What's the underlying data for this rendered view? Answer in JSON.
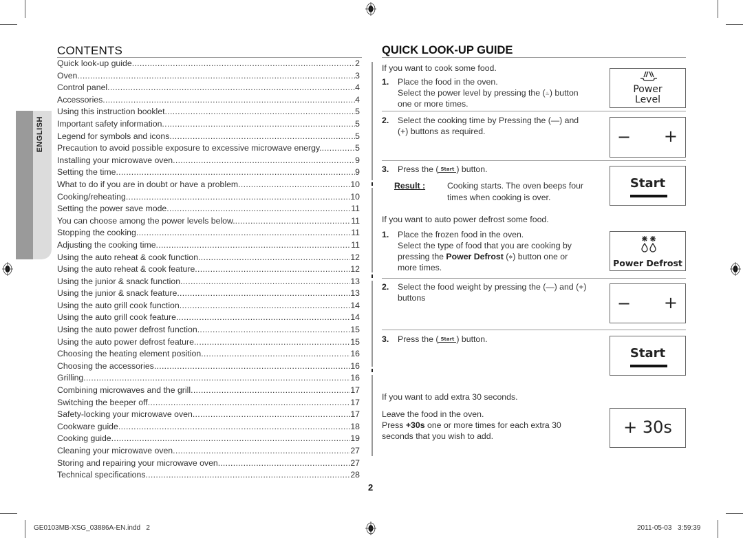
{
  "contents": {
    "title": "CONTENTS",
    "language_tab": "ENGLISH",
    "items": [
      {
        "title": "Quick look-up guide",
        "page": "2"
      },
      {
        "title": "Oven",
        "page": "3"
      },
      {
        "title": "Control panel",
        "page": "4"
      },
      {
        "title": "Accessories",
        "page": "4"
      },
      {
        "title": "Using this instruction booklet",
        "page": "5"
      },
      {
        "title": "Important safety information",
        "page": "5"
      },
      {
        "title": "Legend for symbols and icons",
        "page": "5"
      },
      {
        "title": "Precaution to avoid possible exposure to excessive microwave energy.",
        "page": "5"
      },
      {
        "title": "Installing your microwave oven",
        "page": "9"
      },
      {
        "title": "Setting the time",
        "page": "9"
      },
      {
        "title": "What to do if you are in doubt or have a problem",
        "page": "10"
      },
      {
        "title": "Cooking/reheating",
        "page": "10"
      },
      {
        "title": "Setting the power save mode",
        "page": "11"
      },
      {
        "title": "You can choose among the power levels below.",
        "page": "11"
      },
      {
        "title": "Stopping the cooking",
        "page": "11"
      },
      {
        "title": "Adjusting the cooking time",
        "page": "11"
      },
      {
        "title": "Using the auto reheat & cook function",
        "page": "12"
      },
      {
        "title": "Using the auto reheat & cook feature",
        "page": "12"
      },
      {
        "title": "Using the junior & snack function",
        "page": "13"
      },
      {
        "title": "Using the junior & snack feature",
        "page": "13"
      },
      {
        "title": "Using the auto grill cook function",
        "page": "14"
      },
      {
        "title": "Using the auto grill cook feature",
        "page": "14"
      },
      {
        "title": "Using the auto power defrost function",
        "page": "15"
      },
      {
        "title": "Using the auto power defrost feature",
        "page": "15"
      },
      {
        "title": "Choosing the heating element position",
        "page": "16"
      },
      {
        "title": "Choosing the accessories",
        "page": "16"
      },
      {
        "title": "Grilling",
        "page": "16"
      },
      {
        "title": "Combining microwaves and the grill",
        "page": "17"
      },
      {
        "title": "Switching the beeper off",
        "page": "17"
      },
      {
        "title": "Safety-locking your microwave oven",
        "page": "17"
      },
      {
        "title": "Cookware guide",
        "page": "18"
      },
      {
        "title": "Cooking guide",
        "page": "19"
      },
      {
        "title": "Cleaning your microwave oven",
        "page": "27"
      },
      {
        "title": "Storing and repairing your microwave oven.",
        "page": "27"
      },
      {
        "title": "Technical specifications",
        "page": "28"
      }
    ]
  },
  "guide": {
    "title": "QUICK LOOK-UP GUIDE",
    "cook": {
      "intro": "If you want to cook some food.",
      "step1_num": "1.",
      "step1_line1": "Place the food in the oven.",
      "step1_line2a": "Select the power level by pressing the (",
      "step1_line2b": ") button",
      "step1_line3": "one or more times.",
      "step2_num": "2.",
      "step2_line1": "Select the cooking time by Pressing the (—) and",
      "step2_line2": "(+) buttons as required.",
      "step3_num": "3.",
      "step3_a": "Press the (",
      "step3_b": ") button.",
      "result_label": "Result :",
      "result_line1": "Cooking starts. The oven beeps four",
      "result_line2": "times when cooking is over."
    },
    "defrost": {
      "intro": "If you want to auto power defrost some food.",
      "step1_num": "1.",
      "step1_line1": "Place the frozen food in the oven.",
      "step1_line2": "Select the type of food that you are cooking by",
      "step1_line3a": "pressing the ",
      "step1_line3_bold": "Power Defrost",
      "step1_line3b": " (",
      "step1_line3c": ") button one or",
      "step1_line4": "more times.",
      "step2_num": "2.",
      "step2_line1": "Select the food weight by pressing the (—) and (+)",
      "step2_line2": "buttons",
      "step3_num": "3.",
      "step3_a": "Press the (",
      "step3_b": ") button."
    },
    "extra": {
      "intro": "If you want to add extra 30 seconds.",
      "line1": "Leave the food in the oven.",
      "line2a": "Press ",
      "line2_bold": "+30s",
      "line2b": " one or more times for each extra 30",
      "line3": "seconds that you wish to add."
    },
    "panels": {
      "power_level_line1": "Power",
      "power_level_line2": "Level",
      "minus": "−",
      "plus": "+",
      "start": "Start",
      "power_defrost": "Power Defrost",
      "plus30": "+ 30s",
      "inline_start": "Start",
      "inline_power_level_icon": "♨",
      "inline_defrost_icon": "❄"
    }
  },
  "page_number": "2",
  "footer": {
    "file": "GE0103MB-XSG_03886A-EN.indd   2",
    "date": "2011-05-03",
    "time": "3:59:39"
  }
}
